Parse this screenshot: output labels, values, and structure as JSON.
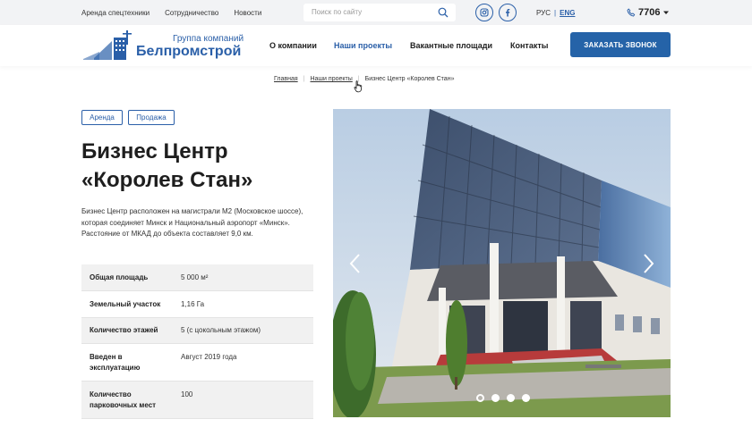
{
  "topbar": {
    "links": [
      "Аренда спецтехники",
      "Сотрудничество",
      "Новости"
    ],
    "search_placeholder": "Поиск по сайту",
    "lang_ru": "РУС",
    "lang_sep": "|",
    "lang_en": "ENG",
    "phone": "7706"
  },
  "header": {
    "logo_sub": "Группа компаний",
    "logo_main": "Белпромстрой",
    "nav": [
      "О компании",
      "Наши проекты",
      "Вакантные площади",
      "Контакты"
    ],
    "nav_active": "Наши проекты",
    "cta": "ЗАКАЗАТЬ ЗВОНОК"
  },
  "breadcrumb": {
    "items": [
      "Главная",
      "Наши проекты",
      "Бизнес Центр «Королев Стан»"
    ],
    "separator": "|"
  },
  "tags": [
    "Аренда",
    "Продажа"
  ],
  "title_line1": "Бизнес Центр",
  "title_line2": "«Королев Стан»",
  "description": "Бизнес Центр расположен на магистрали М2 (Московское шоссе), которая соединяет Минск и Национальный аэропорт «Минск». Расстояние от МКАД до объекта составляет 9,0 км.",
  "specs": [
    {
      "label": "Общая площадь",
      "value": "5 000 м²"
    },
    {
      "label": "Земельный участок",
      "value": "1,16 Га"
    },
    {
      "label": "Количество этажей",
      "value": "5 (с цокольным этажом)"
    },
    {
      "label": "Введен в эксплуатацию",
      "value": "Август 2019 года"
    },
    {
      "label": "Количество парковочных мест",
      "value": "100"
    }
  ],
  "gallery": {
    "slides": 4,
    "current_slide": 1,
    "prev_icon": "chevron-left-icon",
    "next_icon": "chevron-right-icon"
  },
  "colors": {
    "accent": "#2a5fa8",
    "button": "#2563a8",
    "topbar_bg": "#f2f3f5",
    "table_alt": "#f1f1f1"
  }
}
